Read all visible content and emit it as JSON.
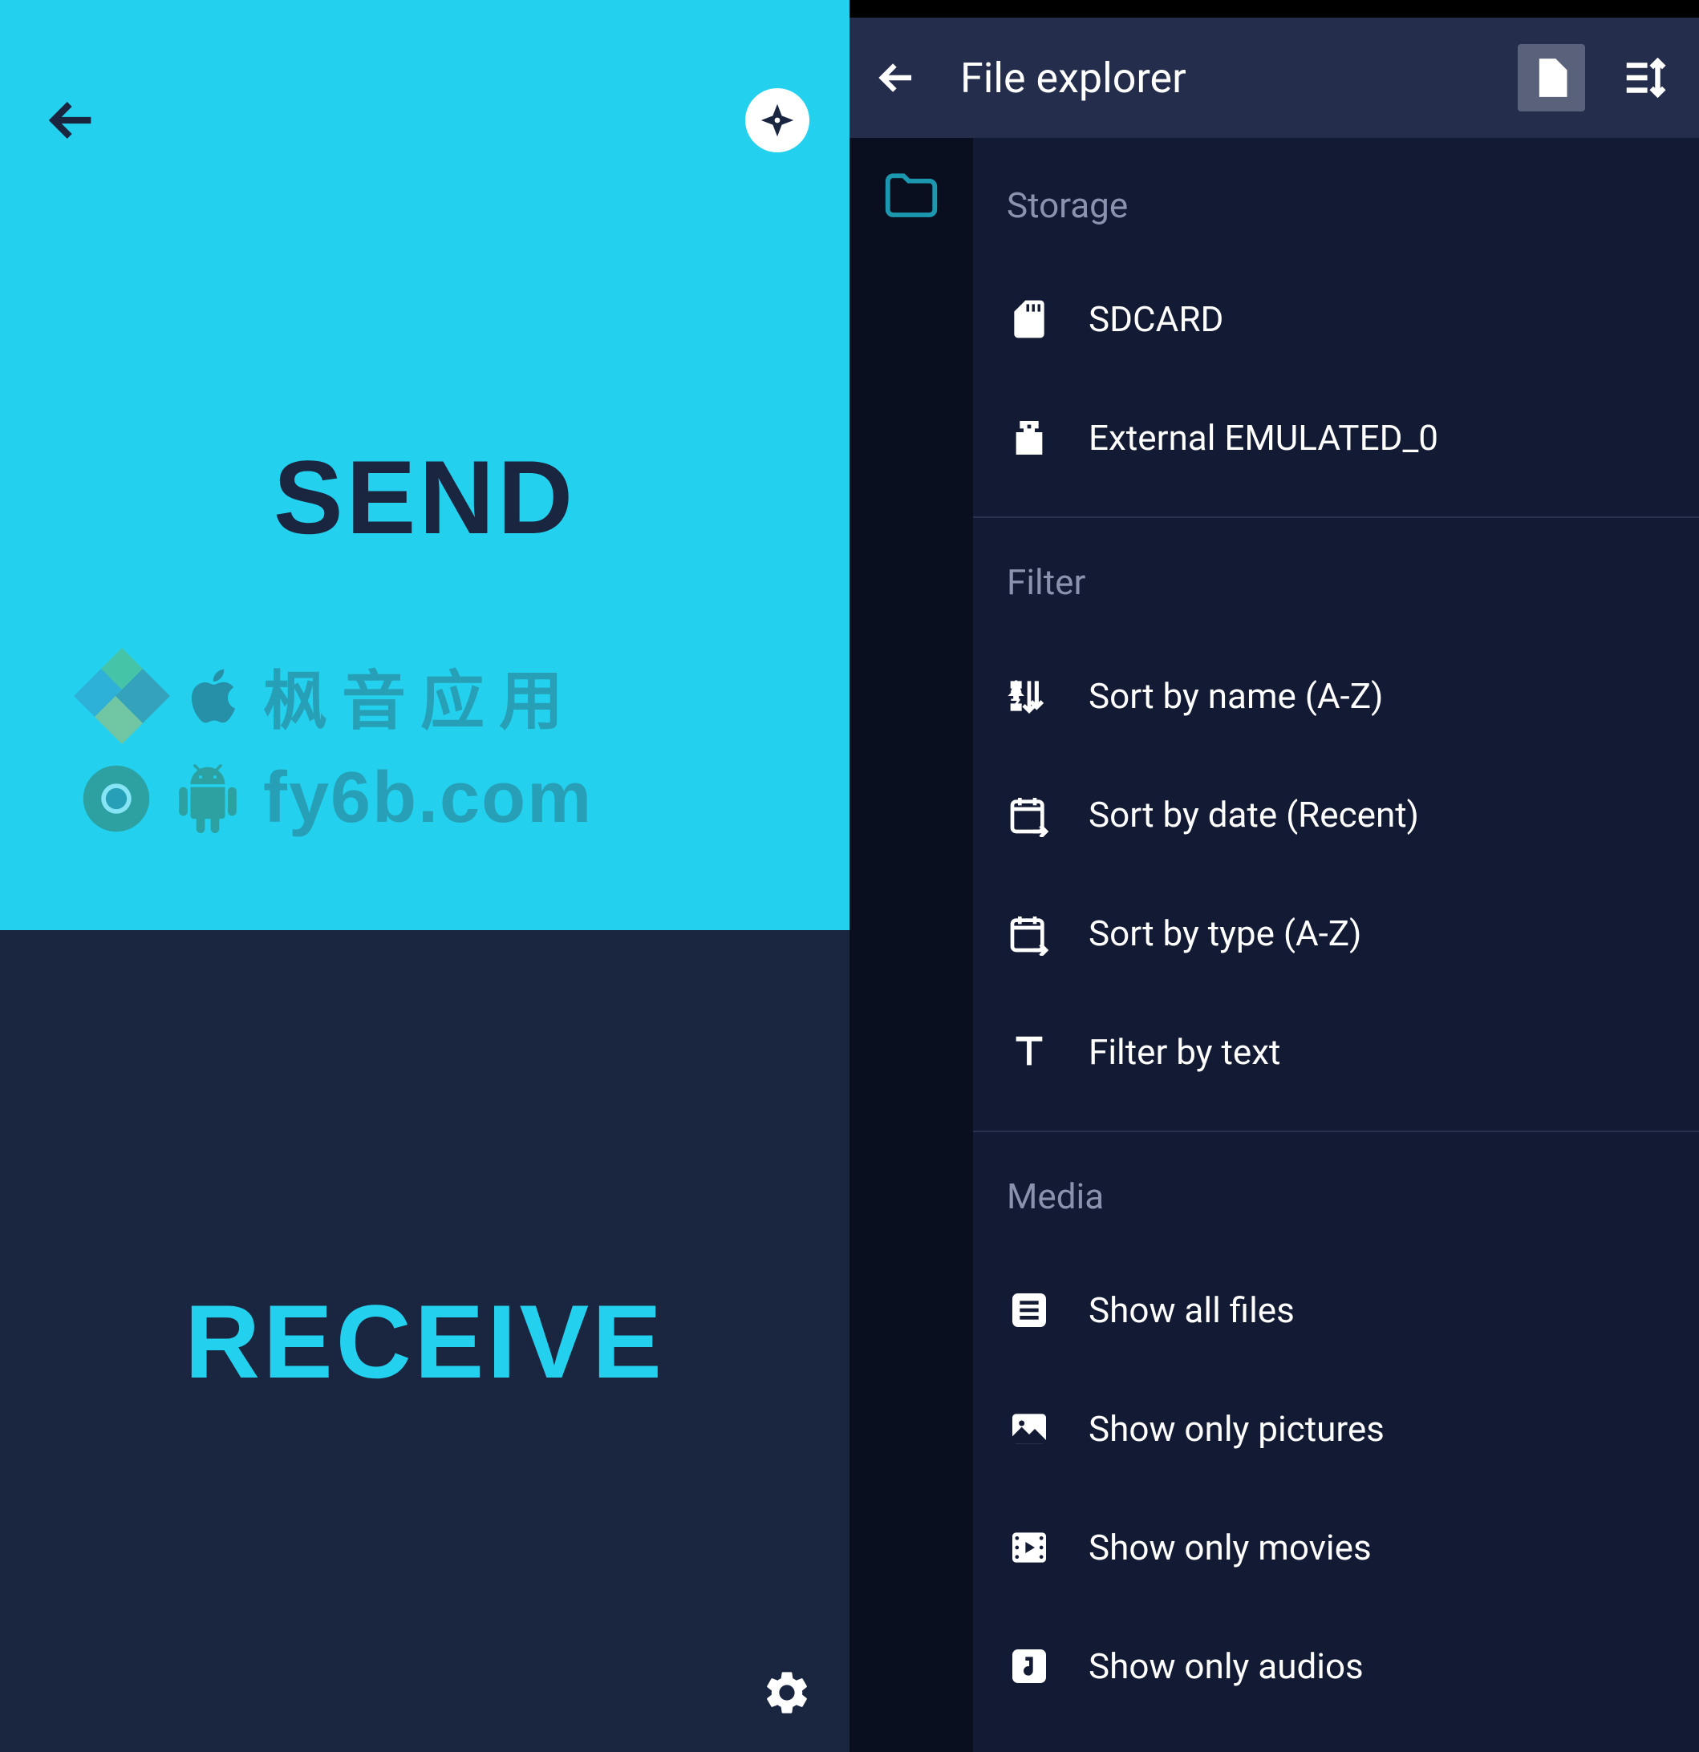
{
  "left": {
    "send_label": "SEND",
    "receive_label": "RECEIVE",
    "watermark": {
      "line1": "枫音应用",
      "line2": "fy6b.com"
    }
  },
  "right": {
    "header_title": "File explorer",
    "sections": {
      "storage": {
        "title": "Storage",
        "items": [
          {
            "icon": "sdcard",
            "label": "SDCARD"
          },
          {
            "icon": "usb",
            "label": "External EMULATED_0"
          }
        ]
      },
      "filter": {
        "title": "Filter",
        "items": [
          {
            "icon": "sort-az",
            "label": "Sort by name (A-Z)"
          },
          {
            "icon": "date-arrow",
            "label": "Sort by date (Recent)"
          },
          {
            "icon": "date-arrow",
            "label": "Sort by type (A-Z)"
          },
          {
            "icon": "text-t",
            "label": "Filter by text"
          }
        ]
      },
      "media": {
        "title": "Media",
        "items": [
          {
            "icon": "list-doc",
            "label": "Show all files"
          },
          {
            "icon": "picture",
            "label": "Show only pictures"
          },
          {
            "icon": "movie",
            "label": "Show only movies"
          },
          {
            "icon": "audio",
            "label": "Show only audios"
          }
        ]
      }
    }
  }
}
